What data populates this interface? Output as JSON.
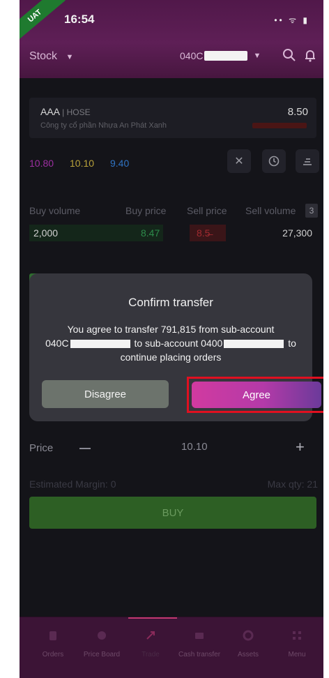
{
  "status_bar": {
    "env_badge": "UAT",
    "time": "16:54",
    "icons": "•• ᯤ ▮"
  },
  "header": {
    "market_select": "Stock",
    "account_prefix": "040C"
  },
  "stock": {
    "symbol": "AAA",
    "exchange": "| HOSE",
    "company": "Công ty cổ phần Nhựa An Phát Xanh",
    "last_price": "8.50",
    "ceiling": "10.80",
    "reference": "10.10",
    "floor": "9.40"
  },
  "order_book": {
    "headers": [
      "Buy volume",
      "Buy price",
      "Sell price",
      "Sell volume"
    ],
    "depth": "3",
    "row": {
      "buy_volume": "2,000",
      "buy_price": "8.47",
      "sell_price": "8.5̶",
      "sell_volume": "27,300"
    }
  },
  "dialog": {
    "title": "Confirm transfer",
    "line1": "You agree to transfer 791,815 from sub-account",
    "from_prefix": "040C",
    "to_text": "to sub-account 0400",
    "to_suffix": "to",
    "line3": "continue placing orders",
    "disagree": "Disagree",
    "agree": "Agree"
  },
  "order_form": {
    "price_label": "Price",
    "price_value": "10.10",
    "estimated_margin": "Estimated Margin: 0",
    "max_qty": "Max qty: 21",
    "buy": "BUY"
  },
  "bottom_nav": [
    {
      "label": "Orders"
    },
    {
      "label": "Price Board"
    },
    {
      "label": "Trade"
    },
    {
      "label": "Cash transfer"
    },
    {
      "label": "Assets"
    },
    {
      "label": "Menu"
    }
  ]
}
